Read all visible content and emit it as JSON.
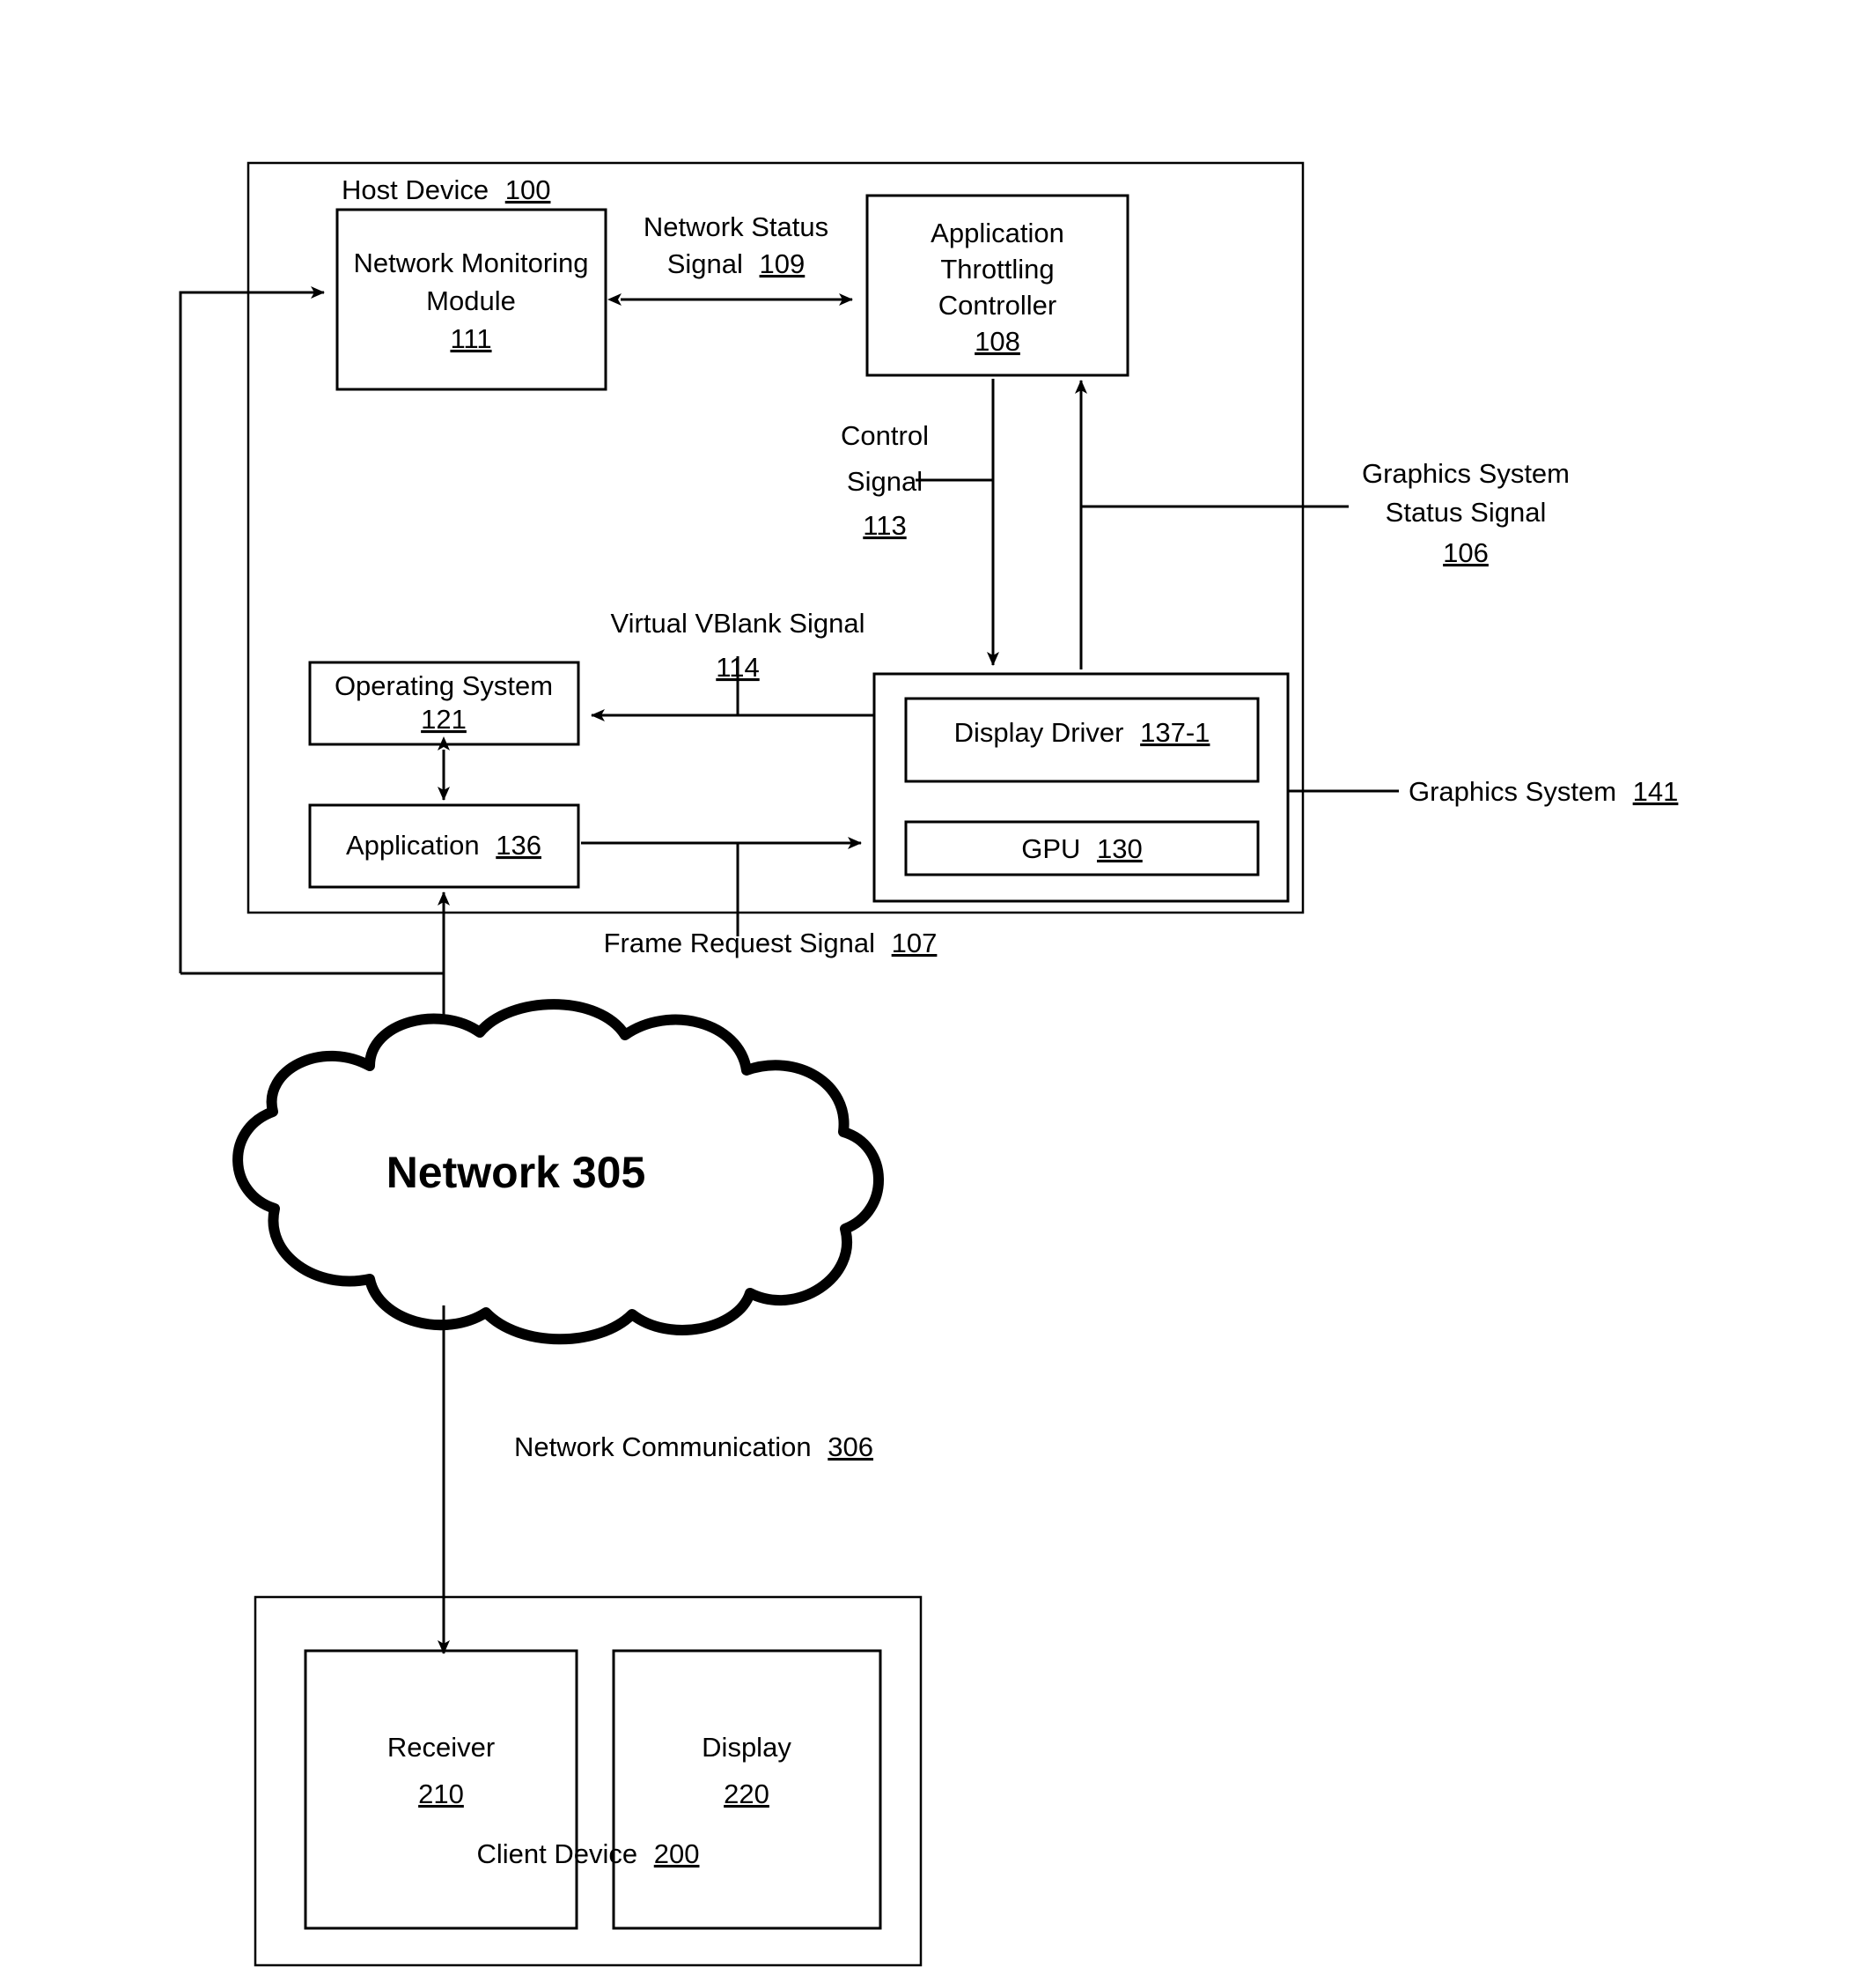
{
  "figure": {
    "title": "Host Device and Client Device graphics throttling block diagram"
  },
  "host_device": {
    "label": "Host Device",
    "ref": "100"
  },
  "blocks": {
    "network_monitoring_module": {
      "line1": "Network Monitoring",
      "line2": "Module",
      "ref": "111"
    },
    "application_throttling_controller": {
      "line1": "Application",
      "line2": "Throttling",
      "line3": "Controller",
      "ref": "108"
    },
    "operating_system": {
      "label": "Operating System",
      "ref": "121"
    },
    "application": {
      "label": "Application",
      "ref": "136"
    },
    "display_driver": {
      "label": "Display Driver",
      "ref": "137-1"
    },
    "gpu": {
      "label": "GPU",
      "ref": "130"
    },
    "receiver": {
      "label": "Receiver",
      "ref": "210"
    },
    "display": {
      "label": "Display",
      "ref": "220"
    }
  },
  "signals": {
    "network_status": {
      "line1": "Network Status",
      "line2": "Signal",
      "ref": "109"
    },
    "control_signal": {
      "line1": "Control",
      "line2": "Signal",
      "ref": "113"
    },
    "graphics_system_status": {
      "line1": "Graphics System",
      "line2": "Status Signal",
      "ref": "106"
    },
    "virtual_vblank": {
      "label": "Virtual VBlank Signal",
      "ref": "114"
    },
    "frame_request": {
      "label": "Frame Request Signal",
      "ref": "107"
    },
    "network_communication": {
      "label": "Network Communication",
      "ref": "306"
    }
  },
  "graphics_system": {
    "label": "Graphics System",
    "ref": "141"
  },
  "network_cloud": {
    "label": "Network 305"
  },
  "client_device": {
    "label": "Client Device",
    "ref": "200"
  },
  "colors": {
    "stroke": "#000000",
    "background": "#ffffff"
  }
}
